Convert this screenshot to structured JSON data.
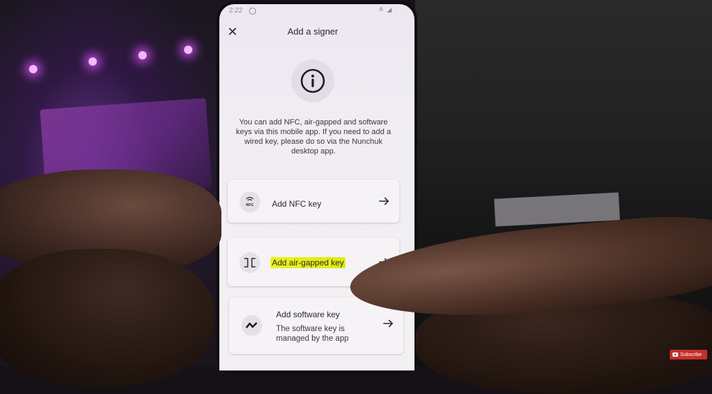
{
  "status_bar": {
    "time": "2:22"
  },
  "header": {
    "title": "Add a signer",
    "close_icon": "close-icon"
  },
  "info": {
    "icon": "info-icon",
    "description": "You can add NFC, air-gapped and software keys via this mobile app. If you need to add a wired key, please do so via the Nunchuk desktop app."
  },
  "options": {
    "nfc": {
      "icon": "nfc-icon",
      "icon_text": "NFC",
      "label": "Add NFC key"
    },
    "air_gapped": {
      "icon": "air-gapped-icon",
      "label": "Add air-gapped key",
      "highlight_color": "#e6f01a"
    },
    "software": {
      "icon": "software-key-icon",
      "label": "Add software key",
      "description": "The software key is managed by the app"
    }
  },
  "overlay": {
    "subscribe_label": "Subscribe",
    "subscribe_color": "#c4302b"
  }
}
